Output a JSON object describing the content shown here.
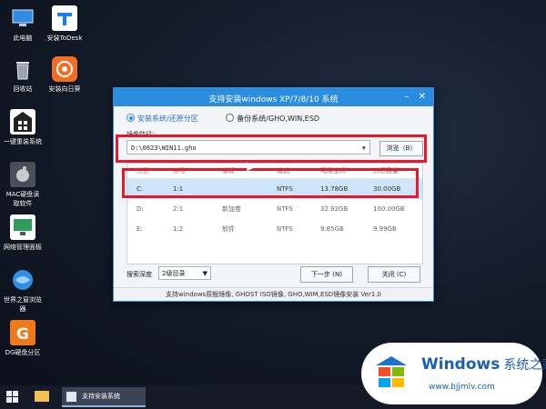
{
  "desktop": {
    "icons": [
      {
        "label": "此电脑",
        "icon": "computer-icon"
      },
      {
        "label": "安装ToDesk",
        "icon": "todesk-icon"
      },
      {
        "label": "回收站",
        "icon": "recycle-bin-icon"
      },
      {
        "label": "安装向日葵",
        "icon": "sunflower-icon"
      },
      {
        "label": "一键重装系统",
        "icon": "reinstall-icon"
      },
      {
        "label": "MAC硬盘读\n取软件",
        "icon": "mac-disk-icon"
      },
      {
        "label": "网络管理面板",
        "icon": "network-icon"
      },
      {
        "label": "世界之窗浏览\n器",
        "icon": "browser-icon"
      },
      {
        "label": "DG硬盘分区",
        "icon": "dg-partition-icon"
      }
    ]
  },
  "window": {
    "title": "支持安装windows XP/7/8/10 系统",
    "radio_install": "安装系统/还原分区",
    "radio_backup": "备份系统/GHO,WIN,ESD",
    "path_label": "镜像路径：",
    "path_value": "D:\\0623\\WIN11.gho",
    "browse_label": "浏览（B）",
    "table": {
      "headers": [
        "分区",
        "序号",
        "卷标",
        "格式",
        "可用空间",
        "分区容量"
      ],
      "rows": [
        [
          "C:",
          "1:1",
          "",
          "NTFS",
          "13.78GB",
          "30.00GB"
        ],
        [
          "D:",
          "2:1",
          "新加卷",
          "NTFS",
          "32.92GB",
          "100.00GB"
        ],
        [
          "E:",
          "1:2",
          "软件",
          "NTFS",
          "9.85GB",
          "9.99GB"
        ]
      ]
    },
    "depth_label": "搜索深度",
    "depth_value": "2级目录",
    "next_label": "下一步 (N)",
    "close_label": "关闭 (C)",
    "footer": "支持windows原版镜像, GHOST ISO镜像, GHO,WIM,ESD镜像安装 Ver1.0"
  },
  "taskbar": {
    "task_label": "支持安装系统"
  },
  "watermark": {
    "brand": "Windows",
    "brand_cn": "系统之家",
    "url": "www.bjjmlv.com"
  },
  "colors": {
    "accent": "#2b8de0",
    "highlight_red": "#e8172b",
    "selected_row": "#cde6fb"
  }
}
